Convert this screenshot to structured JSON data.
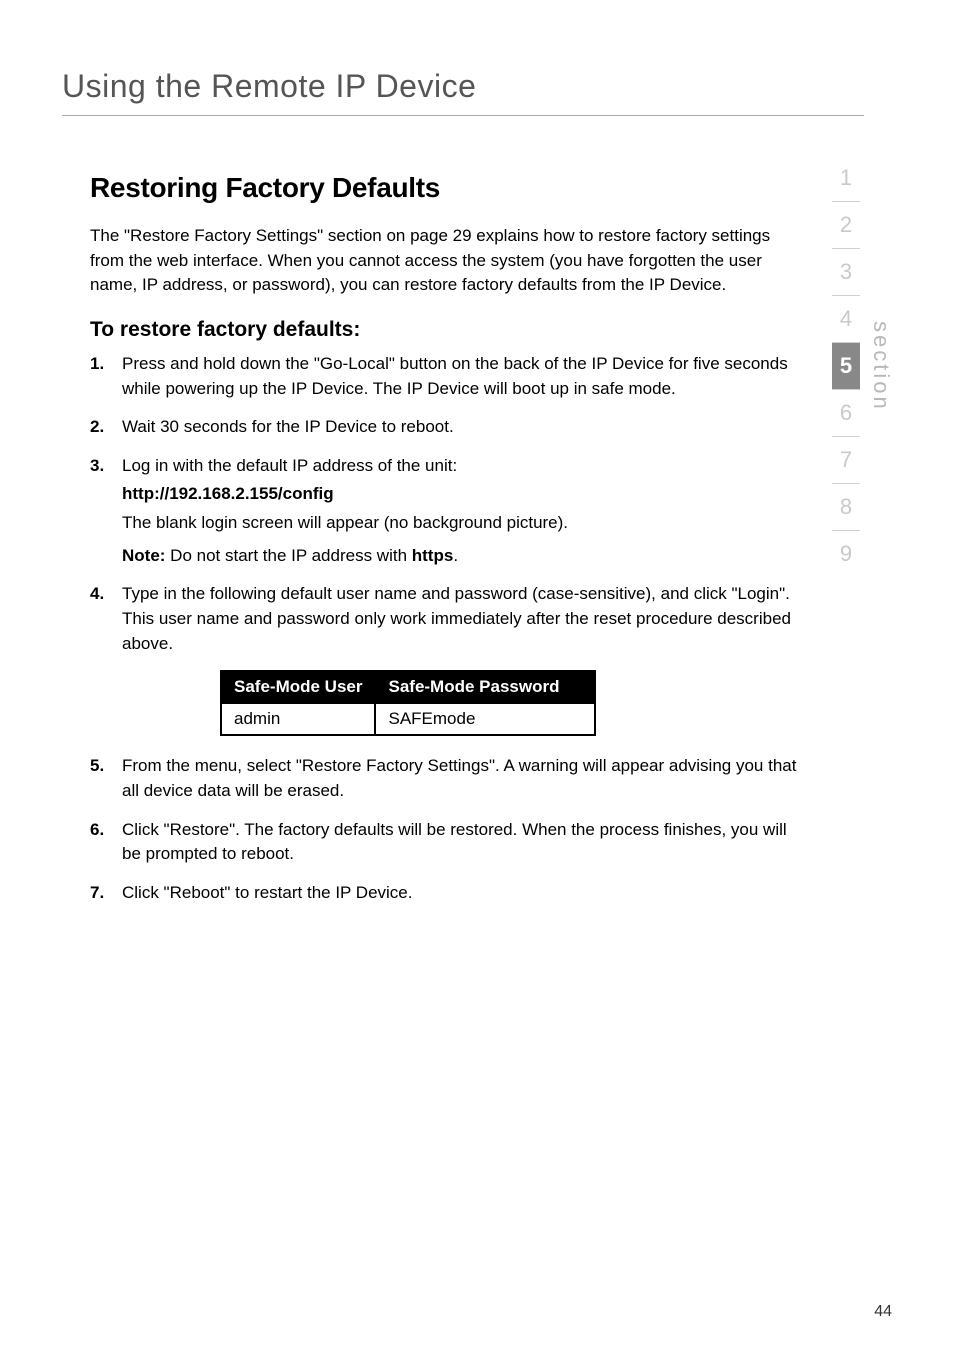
{
  "page_title": "Using the Remote IP Device",
  "section_heading": "Restoring Factory Defaults",
  "intro_paragraph": "The \"Restore Factory Settings\" section on page 29 explains how to restore factory settings from the web interface. When you cannot access the system (you have forgotten the user name, IP address, or password), you can restore factory defaults from the IP Device.",
  "sub_heading": "To restore factory defaults:",
  "steps": [
    {
      "num": "1.",
      "lines": [
        "Press and hold down the \"Go-Local\" button on the back of the IP Device for five seconds while powering up the IP Device. The IP Device will boot up in safe mode."
      ]
    },
    {
      "num": "2.",
      "lines": [
        "Wait 30 seconds for the IP Device to reboot."
      ]
    },
    {
      "num": "3.",
      "lines": [
        "Log in with the default IP address of the unit:",
        "http://192.168.2.155/config",
        "The blank login screen will appear (no background picture)."
      ],
      "bold_line_index": 1,
      "note_prefix": "Note:",
      "note_mid": " Do not start the IP address with ",
      "note_bold2": "https",
      "note_tail": "."
    },
    {
      "num": "4.",
      "lines": [
        "Type in the following default user name and password (case-sensitive), and click \"Login\". This user name and password only work immediately after the reset procedure described above."
      ]
    },
    {
      "num": "5.",
      "lines": [
        "From the menu, select \"Restore Factory Settings\". A warning will appear advising you that all device data will be erased."
      ]
    },
    {
      "num": "6.",
      "lines": [
        "Click \"Restore\". The factory defaults will be restored. When the process finishes, you will be prompted to reboot."
      ]
    },
    {
      "num": "7.",
      "lines": [
        "Click \"Reboot\" to restart the IP Device."
      ]
    }
  ],
  "table": {
    "headers": [
      "Safe-Mode User",
      "Safe-Mode Password"
    ],
    "row": [
      "admin",
      "SAFEmode"
    ]
  },
  "strip": {
    "label": "section",
    "items": [
      "1",
      "2",
      "3",
      "4",
      "5",
      "6",
      "7",
      "8",
      "9"
    ],
    "selected": "5"
  },
  "page_number": "44"
}
